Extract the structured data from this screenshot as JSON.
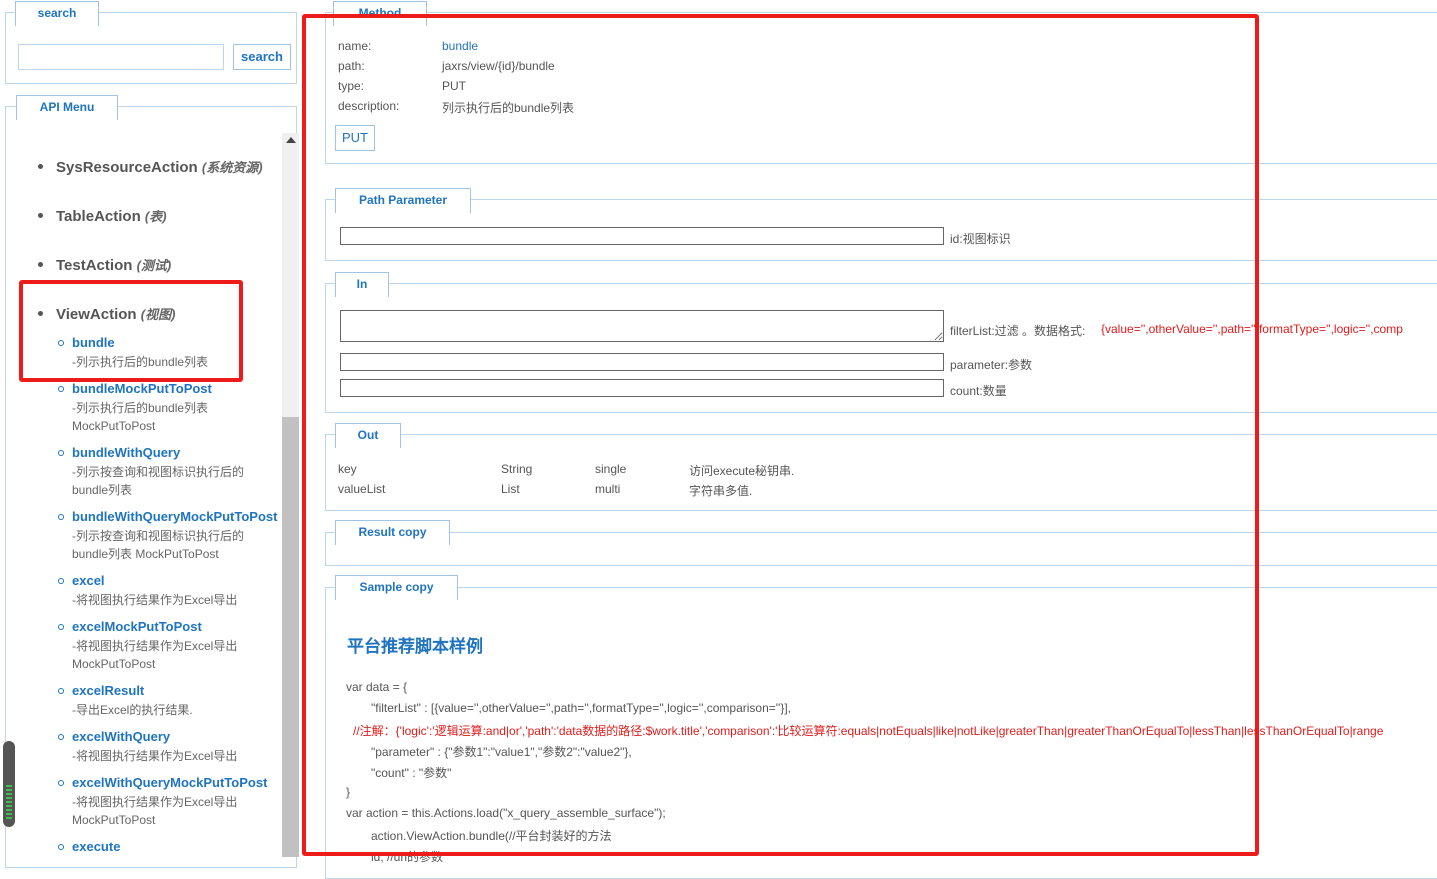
{
  "search": {
    "tab_label": "search",
    "input_value": "",
    "button_label": "search"
  },
  "api_menu": {
    "tab_label": "API Menu",
    "items": [
      {
        "name": "SysResourceAction",
        "note": "(系统资源)"
      },
      {
        "name": "TableAction",
        "note": "(表)"
      },
      {
        "name": "TestAction",
        "note": "(测试)"
      },
      {
        "name": "ViewAction",
        "note": "(视图)"
      }
    ],
    "sub_items": [
      {
        "name": "bundle",
        "desc": "-列示执行后的bundle列表"
      },
      {
        "name": "bundleMockPutToPost",
        "desc": "-列示执行后的bundle列表 MockPutToPost"
      },
      {
        "name": "bundleWithQuery",
        "desc": "-列示按查询和视图标识执行后的bundle列表"
      },
      {
        "name": "bundleWithQueryMockPutToPost",
        "desc": "-列示按查询和视图标识执行后的bundle列表 MockPutToPost"
      },
      {
        "name": "excel",
        "desc": "-将视图执行结果作为Excel导出"
      },
      {
        "name": "excelMockPutToPost",
        "desc": "-将视图执行结果作为Excel导出 MockPutToPost"
      },
      {
        "name": "excelResult",
        "desc": "-导出Excel的执行结果."
      },
      {
        "name": "excelWithQuery",
        "desc": "-将视图执行结果作为Excel导出"
      },
      {
        "name": "excelWithQueryMockPutToPost",
        "desc": "-将视图执行结果作为Excel导出 MockPutToPost"
      },
      {
        "name": "execute",
        "desc": ""
      }
    ]
  },
  "method": {
    "tab_label": "Method",
    "name_label": "name:",
    "name_value": "bundle",
    "path_label": "path:",
    "path_value": "jaxrs/view/{id}/bundle",
    "type_label": "type:",
    "type_value": "PUT",
    "description_label": "description:",
    "description_value": "列示执行后的bundle列表",
    "button_label": "PUT"
  },
  "path_parameter": {
    "tab_label": "Path Parameter",
    "param_label": "id:视图标识"
  },
  "in": {
    "tab_label": "In",
    "filter_label": "filterList:过滤 。数据格式:",
    "filter_format": "{value='',otherValue='',path='',formatType='',logic='',comp",
    "parameter_label": "parameter:参数",
    "count_label": "count:数量"
  },
  "out": {
    "tab_label": "Out",
    "rows": [
      {
        "name": "key",
        "type": "String",
        "mode": "single",
        "desc": "访问execute秘钥串."
      },
      {
        "name": "valueList",
        "type": "List",
        "mode": "multi",
        "desc": "字符串多值."
      }
    ]
  },
  "result": {
    "tab_label": "Result copy"
  },
  "sample": {
    "tab_label": "Sample copy",
    "heading": "平台推荐脚本样例",
    "lines": [
      "var data = {",
      "\"filterList\" : [{value='',otherValue='',path='',formatType='',logic='',comparison=''}],",
      "//注解：{'logic':'逻辑运算:and|or','path':'data数据的路径:$work.title','comparison':'比较运算符:equals|notEquals|like|notLike|greaterThan|greaterThanOrEqualTo|lessThan|lessThanOrEqualTo|range",
      "\"parameter\" : {\"参数1\":\"value1\",\"参数2\":\"value2\"},",
      "\"count\" : \"参数\"",
      "}",
      "var action = this.Actions.load(\"x_query_assemble_surface\");",
      "action.ViewAction.bundle(//平台封装好的方法",
      "id, //uri的参数"
    ]
  },
  "colors": {
    "accent": "#1f74c0",
    "border": "#bcd6ee",
    "highlight": "#ee1b1b",
    "annotation": "#e01b1b"
  }
}
